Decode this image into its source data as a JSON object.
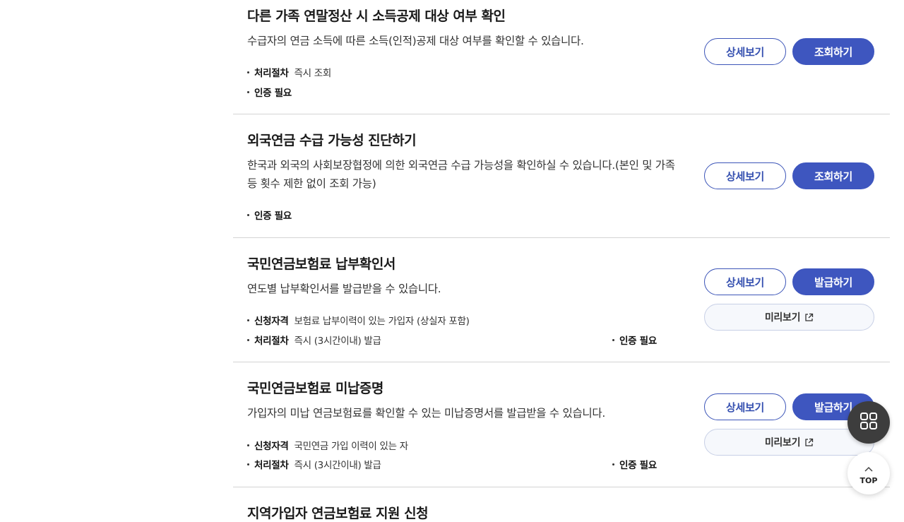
{
  "items": [
    {
      "title": "다른 가족 연말정산 시 소득공제 대상 여부 확인",
      "desc": "수급자의 연금 소득에 따른 소득(인적)공제 대상 여부를 확인할 수 있습니다.",
      "meta": [
        {
          "key": "처리절차",
          "value": "즉시 조회"
        },
        {
          "key": "인증 필요",
          "value": ""
        }
      ],
      "detail_label": "상세보기",
      "action_label": "조회하기"
    },
    {
      "title": "외국연금 수급 가능성 진단하기",
      "desc": "한국과 외국의 사회보장협정에 의한 외국연금 수급 가능성을 확인하실 수 있습니다.(본인 및 가족 등 횟수 제한 없이 조회 가능)",
      "meta": [
        {
          "key": "인증 필요",
          "value": ""
        }
      ],
      "detail_label": "상세보기",
      "action_label": "조회하기"
    },
    {
      "title": "국민연금보험료 납부확인서",
      "desc": "연도별 납부확인서를 발급받을 수 있습니다.",
      "meta": [
        {
          "key": "신청자격",
          "value": "보험료 납부이력이 있는 가입자 (상실자 포함)"
        },
        {
          "key": "처리절차",
          "value": "즉시 (3시간이내) 발급"
        },
        {
          "key": "인증 필요",
          "value": ""
        }
      ],
      "detail_label": "상세보기",
      "action_label": "발급하기",
      "preview_label": "미리보기"
    },
    {
      "title": "국민연금보험료 미납증명",
      "desc": "가입자의 미납 연금보험료를 확인할 수 있는 미납증명서를 발급받을 수 있습니다.",
      "meta": [
        {
          "key": "신청자격",
          "value": "국민연금 가입 이력이 있는 자"
        },
        {
          "key": "처리절차",
          "value": "즉시 (3시간이내) 발급"
        },
        {
          "key": "인증 필요",
          "value": ""
        }
      ],
      "detail_label": "상세보기",
      "action_label": "발급하기",
      "preview_label": "미리보기"
    },
    {
      "title": "지역가입자 연금보험료 지원 신청"
    }
  ],
  "fab": {
    "top_label": "TOP",
    "menu_icon": "grid-menu-icon"
  },
  "colors": {
    "primary": "#3e56bf",
    "border": "#d4d4d4"
  }
}
